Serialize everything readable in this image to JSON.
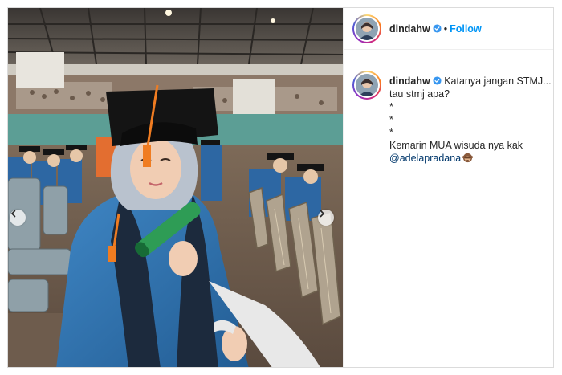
{
  "post": {
    "username": "dindahw",
    "follow_label": "Follow",
    "separator": "•",
    "caption_lines": [
      "Katanya jangan STMJ...",
      "tau stmj apa?",
      "*",
      "*",
      "*",
      "Kemarin MUA wisuda nya kak"
    ],
    "mention": "@adelapradana"
  },
  "colors": {
    "accent": "#0095f6",
    "mention": "#00376b",
    "verified": "#3897f0",
    "gown": "#2f6fa8",
    "cap": "#141414",
    "tassel": "#f07c21"
  },
  "icons": {
    "verified": "verified-badge-icon",
    "prev": "chevron-left-icon",
    "next": "chevron-right-icon",
    "emoji": "see-no-evil-monkey-emoji"
  }
}
